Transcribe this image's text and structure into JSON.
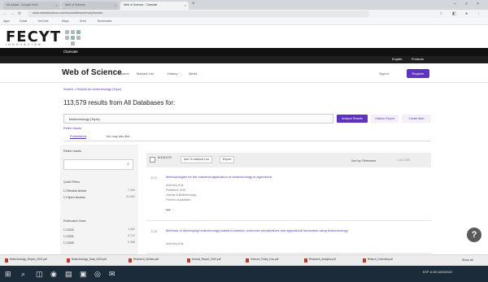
{
  "browser": {
    "tabs": [
      {
        "label": "Mi unidad - Google Drive"
      },
      {
        "label": "Web of Science"
      },
      {
        "label": "Web of Science - Clarivate"
      }
    ],
    "new_tab": "+",
    "close": "×",
    "window_controls": [
      "–",
      "□",
      "×"
    ],
    "nav": {
      "back": "←",
      "forward": "→",
      "reload": "⟳"
    },
    "url": "www.webofscience.com/wos/alldb/summary/results",
    "bookmarks": [
      "Apps",
      "Gmail",
      "YouTube",
      "Maps",
      "Drive",
      "Bookmarks"
    ]
  },
  "fecyt": {
    "logo": "FECYT",
    "subtitle": "INNOVACION"
  },
  "clarivate": {
    "label": "Clarivate"
  },
  "wos_top": {
    "english": "English",
    "products": "Products"
  },
  "wos_nav": {
    "title": "Web of Science",
    "links": [
      "Search",
      "Marked List",
      "History",
      "Alerts"
    ],
    "sign_in": "Sign In",
    "register": "Register"
  },
  "breadcrumb": "Search > Results for biotechnology (Topic)",
  "results": {
    "title": "113,579 results from All Databases for:",
    "query": "biotechnology (Topic)",
    "add_keywords": "Refine results",
    "analyze": "Analyze Results",
    "citation": "Citation Report",
    "alert": "Create Alert"
  },
  "result_tabs": [
    "Publications",
    "You may also like..."
  ],
  "filter": {
    "heading": "Refine results",
    "search_icon": "search-icon",
    "quick_filters": "Quick Filters",
    "options": [
      {
        "label": "Review Article",
        "count": "7,426"
      },
      {
        "label": "Open Access",
        "count": "41,052"
      }
    ],
    "years_heading": "Publication Years",
    "years": [
      {
        "label": "2022",
        "count": "1,082"
      },
      {
        "label": "2021",
        "count": "9,712"
      },
      {
        "label": "2020",
        "count": "9,388"
      }
    ]
  },
  "toolbar": {
    "page_info": "0/113,579",
    "add_marked": "Add To Marked List",
    "export": "Export",
    "sort_by": "Sort by: Relevance",
    "pager": "1 of 2,000"
  },
  "records": [
    {
      "num": "1",
      "title": "Methodologies for the industrial application of biotechnology in agriculture",
      "meta": [
        "Author(s) et al.",
        "Published: 2020",
        "Journal of Biotechnology",
        "Full text at publisher"
      ]
    },
    {
      "num": "2",
      "title": "Methods of developing biotechnology-based industries: economic perspectives and agricultural innovation using biotechnology",
      "meta": [
        "Author(s) et al."
      ]
    }
  ],
  "help": "?",
  "downloads": [
    "Biotechnology_Report_2021.pdf",
    "Biotechnology_Data_2020.pdf",
    "Research_Metrics.pdf",
    "Annual_Report_2019.pdf",
    "Science_Policy_Doc.pdf",
    "Research_Analysis.pdf",
    "Biotech_Overview.pdf"
  ],
  "show_all": "Show all",
  "taskbar": {
    "start": "⊞",
    "search": "⌕",
    "task_view": "◫",
    "edge": "◉",
    "explorer": "▤",
    "store": "▣",
    "chrome": "◎",
    "mail": "✉",
    "tray": "ESP 11:55 18/03/2022"
  }
}
